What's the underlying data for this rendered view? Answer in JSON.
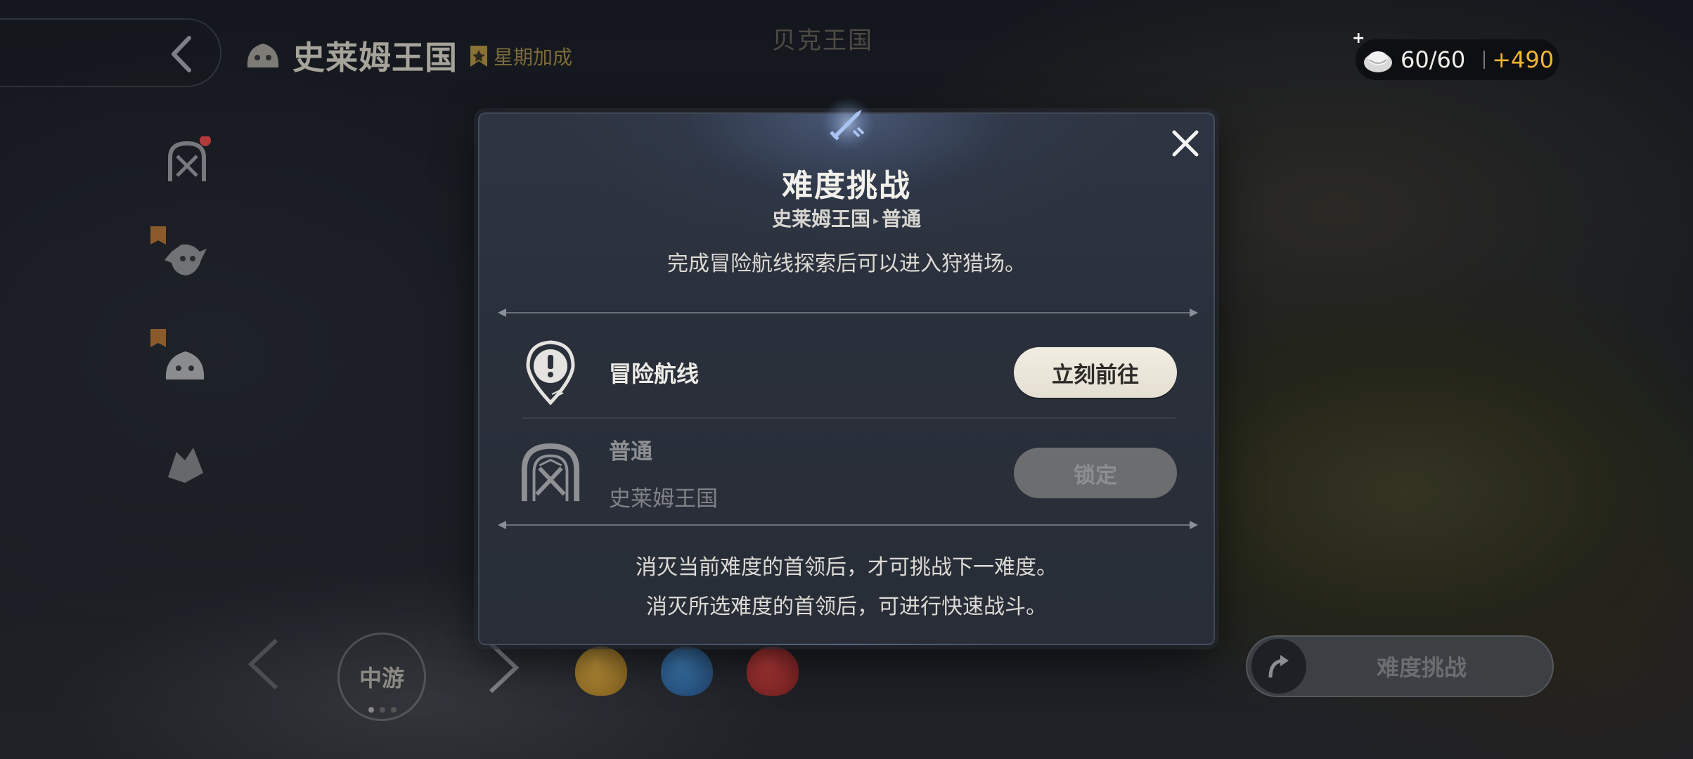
{
  "header": {
    "region_name": "史莱姆王国",
    "week_bonus_label": "星期加成",
    "map_label": "贝克王国"
  },
  "resource": {
    "count": "60/60",
    "bonus": "+490",
    "plus_label": "+"
  },
  "bottom": {
    "stage_label": "中游",
    "difficulty_button_label": "难度挑战"
  },
  "modal": {
    "title": "难度挑战",
    "subtitle_region": "史莱姆王国",
    "subtitle_level": "普通",
    "description": "完成冒险航线探索后可以进入狩猎场。",
    "route": {
      "label": "冒险航线",
      "button_label": "立刻前往"
    },
    "difficulty": {
      "level": "普通",
      "region": "史莱姆王国",
      "button_label": "锁定"
    },
    "footer_line1": "消灭当前难度的首领后，才可挑战下一难度。",
    "footer_line2": "消灭所选难度的首领后，可进行快速战斗。"
  },
  "colors": {
    "accent_gold": "#f2b632",
    "go_button_bg": "#ece7da",
    "lock_button_bg": "#6c6d6e",
    "modal_bg": "#2b313c"
  },
  "icons": [
    "back-arrow-icon",
    "slime-icon",
    "bonus-badge-icon",
    "arena-icon",
    "goblin-icon",
    "crystal-icon",
    "close-icon",
    "sword-emblem-icon",
    "route-pin-icon",
    "arena-gate-icon",
    "resource-icon",
    "curved-arrow-icon",
    "chevron-left-icon",
    "chevron-right-icon"
  ]
}
